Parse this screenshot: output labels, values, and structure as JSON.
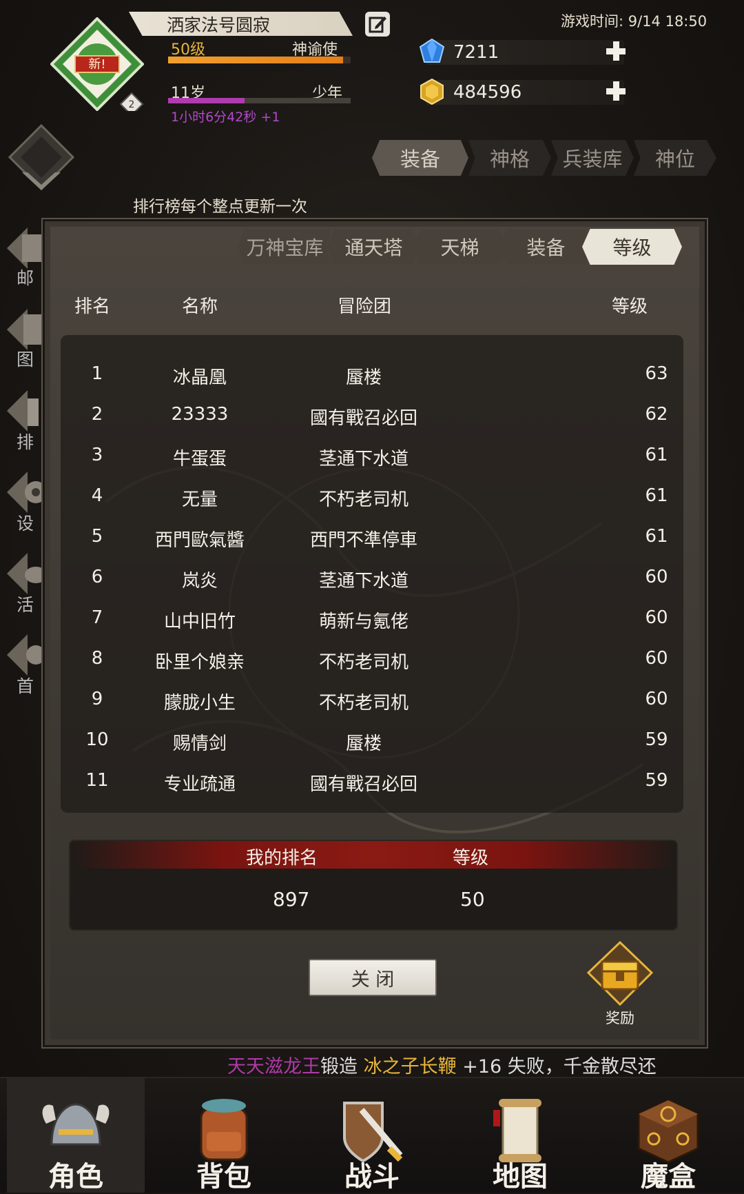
{
  "header": {
    "player_name": "洒家法号圆寂",
    "avatar_badge": "新!",
    "avatar_count": "2",
    "level": "50级",
    "title": "神谕使",
    "age": "11岁",
    "age_stage": "少年",
    "timer": "1小时6分42秒 +1",
    "level_progress_pct": 96,
    "age_progress_pct": 42,
    "game_time": "游戏时间: 9/14 18:50",
    "gems": "7211",
    "gold": "484596"
  },
  "main_tabs": [
    "装备",
    "神格",
    "兵装库",
    "神位"
  ],
  "side_menu": [
    "邮",
    "图",
    "排",
    "设",
    "活",
    "首"
  ],
  "rank_note": "排行榜每个整点更新一次",
  "sub_tabs": [
    "万神宝库",
    "通天塔",
    "天梯",
    "装备",
    "等级"
  ],
  "table": {
    "headers": [
      "排名",
      "名称",
      "冒险团",
      "等级"
    ],
    "rows": [
      [
        "1",
        "冰晶凰",
        "蜃楼",
        "63"
      ],
      [
        "2",
        "23333",
        "國有戰召必回",
        "62"
      ],
      [
        "3",
        "牛蛋蛋",
        "茎通下水道",
        "61"
      ],
      [
        "4",
        "无量",
        "不朽老司机",
        "61"
      ],
      [
        "5",
        "西門歐氣醬",
        "西門不準停車",
        "61"
      ],
      [
        "6",
        "岚炎",
        "茎通下水道",
        "60"
      ],
      [
        "7",
        "山中旧竹",
        "萌新与氪佬",
        "60"
      ],
      [
        "8",
        "卧里个娘亲",
        "不朽老司机",
        "60"
      ],
      [
        "9",
        "朦胧小生",
        "不朽老司机",
        "60"
      ],
      [
        "10",
        "赐情剑",
        "蜃楼",
        "59"
      ],
      [
        "11",
        "专业疏通",
        "國有戰召必回",
        "59"
      ]
    ]
  },
  "my_rank": {
    "label_rank": "我的排名",
    "label_level": "等级",
    "rank": "897",
    "level": "50"
  },
  "close_label": "关 闭",
  "reward_label": "奖励",
  "ticker": {
    "player": "天天滋龙王",
    "action": "锻造",
    "item": "冰之子长鞭",
    "rest": "+16 失败，千金散尽还"
  },
  "nav": [
    "角色",
    "背包",
    "战斗",
    "地图",
    "魔盒"
  ],
  "colors": {
    "accent_gold": "#e8b53a",
    "purple_text": "#b04ac8",
    "ticker_player": "#b03aa8",
    "ticker_item": "#e8b53a",
    "rank_header_red": "#8a1a14"
  }
}
